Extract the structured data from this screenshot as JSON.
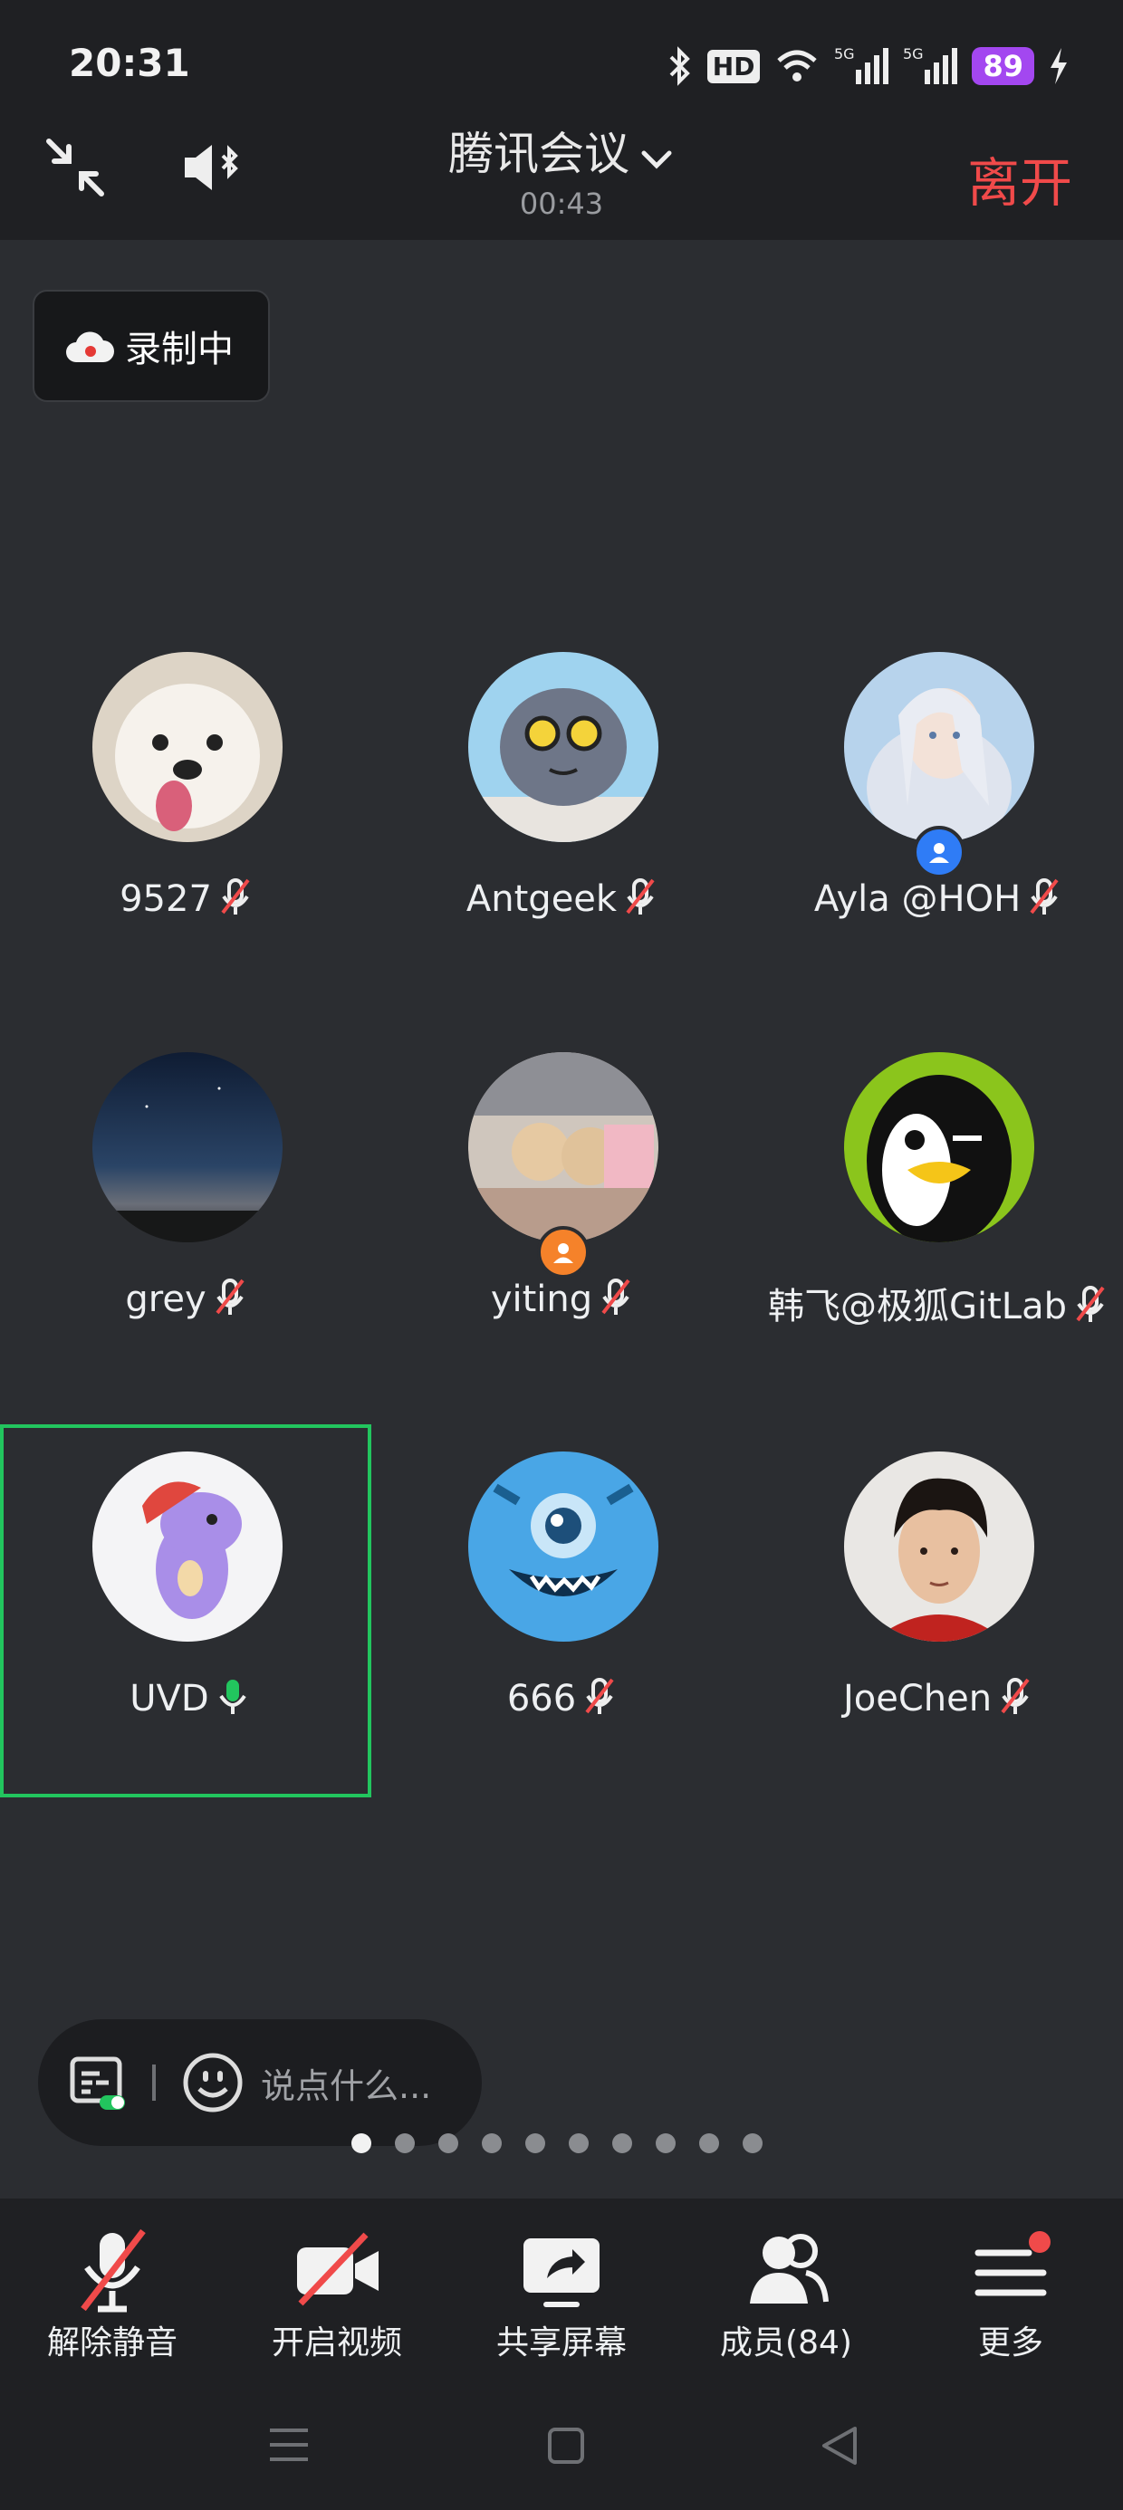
{
  "status_bar": {
    "time": "20:31",
    "battery": "89",
    "network_labels": [
      "HD",
      "5G",
      "5G"
    ]
  },
  "header": {
    "title": "腾讯会议",
    "elapsed": "00:43",
    "leave_label": "离开"
  },
  "recording": {
    "label": "录制中"
  },
  "participants": [
    {
      "name": "9527",
      "mic": "muted",
      "badge": ""
    },
    {
      "name": "Antgeek",
      "mic": "muted",
      "badge": ""
    },
    {
      "name": "Ayla @HOH",
      "mic": "muted",
      "badge": "host"
    },
    {
      "name": "grey",
      "mic": "muted",
      "badge": ""
    },
    {
      "name": "yiting",
      "mic": "muted",
      "badge": "cohost"
    },
    {
      "name": "韩飞@极狐GitLab",
      "mic": "muted",
      "badge": ""
    },
    {
      "name": "UVD",
      "mic": "on",
      "badge": "",
      "active_speaker": true
    },
    {
      "name": "666",
      "mic": "muted",
      "badge": ""
    },
    {
      "name": "JoeChen",
      "mic": "muted",
      "badge": ""
    }
  ],
  "chat": {
    "placeholder": "说点什么..."
  },
  "pager": {
    "total": 10,
    "current": 1
  },
  "toolbar": {
    "unmute": "解除静音",
    "video": "开启视频",
    "share": "共享屏幕",
    "members": "成员(84)",
    "more": "更多"
  },
  "colors": {
    "leave": "#f04a4a",
    "active_border": "#22c55e",
    "mic_on": "#22c55e",
    "host_badge": "#2f7cf6",
    "cohost_badge": "#f5822a",
    "notify_dot": "#f04a4a"
  }
}
